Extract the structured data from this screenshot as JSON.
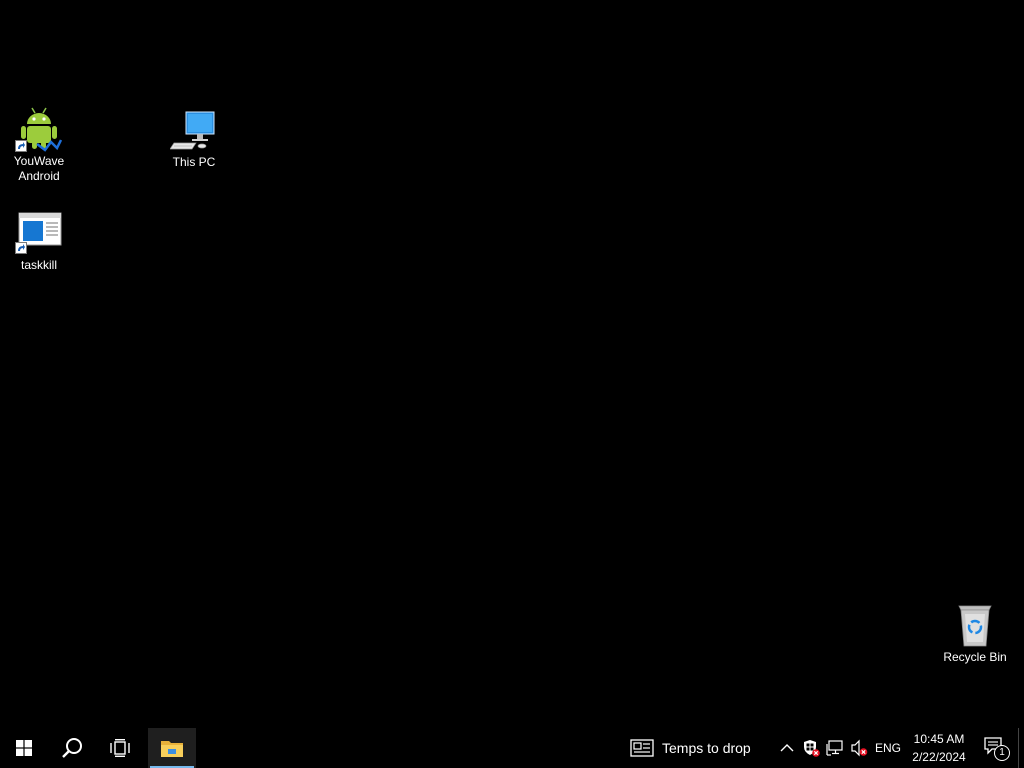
{
  "desktop": {
    "icons": [
      {
        "label_line1": "YouWave",
        "label_line2": "Android",
        "icon": "android-icon"
      },
      {
        "label_line1": "This PC",
        "icon": "computer-icon"
      },
      {
        "label_line1": "taskkill",
        "icon": "application-window-icon"
      },
      {
        "label_line1": "Recycle Bin",
        "icon": "recycle-bin-icon"
      }
    ]
  },
  "taskbar": {
    "start_icon": "windows-logo-icon",
    "search_icon": "search-icon",
    "task_view_icon": "task-view-icon",
    "pinned": [
      {
        "icon": "file-explorer-icon",
        "active": true
      }
    ],
    "news": {
      "text": "Temps to drop",
      "icon": "news-icon"
    },
    "tray": {
      "chevron_icon": "chevron-up-icon",
      "security_icon": "windows-security-icon",
      "network_icon": "network-disconnected-icon",
      "volume_icon": "volume-muted-icon",
      "language": "ENG"
    },
    "clock": {
      "time": "10:45 AM",
      "date": "2/22/2024"
    },
    "notifications": {
      "count": "1",
      "icon": "action-center-icon"
    }
  },
  "colors": {
    "desktop_background": "#000000",
    "taskbar_background": "#000000",
    "active_indicator": "#76b9ed"
  }
}
